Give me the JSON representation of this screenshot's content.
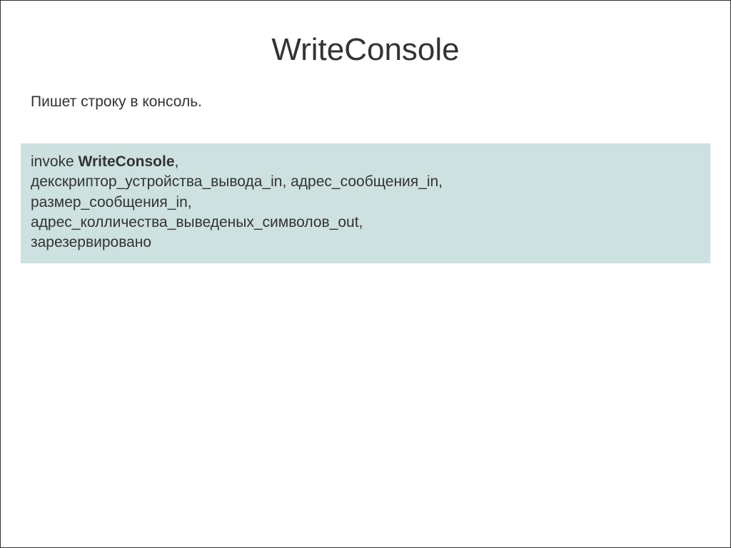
{
  "title": "WriteConsole",
  "description": "Пишет строку в консоль.",
  "code": {
    "invoke": "invoke ",
    "function_name": "WriteConsole",
    "comma": ",",
    "line2": "декскриптор_устройства_вывода_in, адрес_сообщения_in,",
    "line3": "размер_сообщения_in,",
    "line4": "адрес_колличества_выведеных_символов_out,",
    "line5": "зарезервировано"
  }
}
